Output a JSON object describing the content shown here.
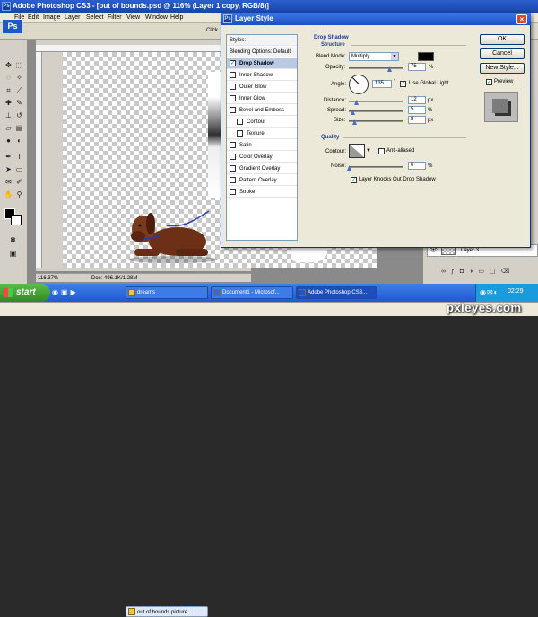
{
  "app": {
    "title": "Adobe Photoshop CS3 - [out of bounds.psd @ 116% (Layer 1 copy, RGB/8)]",
    "logo": "Ps"
  },
  "menu": [
    "File",
    "Edit",
    "Image",
    "Layer",
    "Select",
    "Filter",
    "View",
    "Window",
    "Help"
  ],
  "options_bar": {
    "partial_label": "Click"
  },
  "doc_status": {
    "zoom": "116.37%",
    "doc": "Doc: 496.1K/1.28M"
  },
  "dialog": {
    "title": "Layer Style",
    "styles_list": {
      "header": "Styles",
      "blending_options": "Blending Options: Default",
      "items": [
        {
          "label": "Drop Shadow",
          "checked": true,
          "selected": true
        },
        {
          "label": "Inner Shadow",
          "checked": false
        },
        {
          "label": "Outer Glow",
          "checked": false
        },
        {
          "label": "Inner Glow",
          "checked": false
        },
        {
          "label": "Bevel and Emboss",
          "checked": false
        },
        {
          "label": "Contour",
          "checked": false,
          "sub": true
        },
        {
          "label": "Texture",
          "checked": false,
          "sub": true
        },
        {
          "label": "Satin",
          "checked": false
        },
        {
          "label": "Color Overlay",
          "checked": false
        },
        {
          "label": "Gradient Overlay",
          "checked": false
        },
        {
          "label": "Pattern Overlay",
          "checked": false
        },
        {
          "label": "Stroke",
          "checked": false
        }
      ]
    },
    "drop_shadow": {
      "section_title": "Drop Shadow",
      "structure_title": "Structure",
      "blend_mode_label": "Blend Mode:",
      "blend_mode_value": "Multiply",
      "shadow_color": "#000000",
      "opacity_label": "Opacity:",
      "opacity_value": "75",
      "angle_label": "Angle:",
      "angle_value": "135",
      "angle_unit": "°",
      "use_global_light_label": "Use Global Light",
      "use_global_light_checked": true,
      "distance_label": "Distance:",
      "distance_value": "12",
      "spread_label": "Spread:",
      "spread_value": "5",
      "size_label": "Size:",
      "size_value": "8",
      "unit_px": "px",
      "unit_pct": "%",
      "quality_title": "Quality",
      "contour_label": "Contour:",
      "anti_aliased_label": "Anti-aliased",
      "anti_aliased_checked": false,
      "noise_label": "Noise:",
      "noise_value": "0",
      "knockout_label": "Layer Knocks Out Drop Shadow",
      "knockout_checked": true
    },
    "buttons": {
      "ok": "OK",
      "cancel": "Cancel",
      "new_style": "New Style...",
      "preview_label": "Preview",
      "preview_checked": true
    }
  },
  "layers": {
    "row_name": "Layer 3"
  },
  "taskbar": {
    "start": "start",
    "tasks": [
      {
        "label": "dreams",
        "active": false
      },
      {
        "label": "Document1 - Microsof...",
        "active": false
      },
      {
        "label": "Adobe Photoshop CS3...",
        "active": true
      }
    ],
    "second_row_task": "out of bounds picture....",
    "clock": "02:29"
  },
  "watermark": "pxleyes.com"
}
